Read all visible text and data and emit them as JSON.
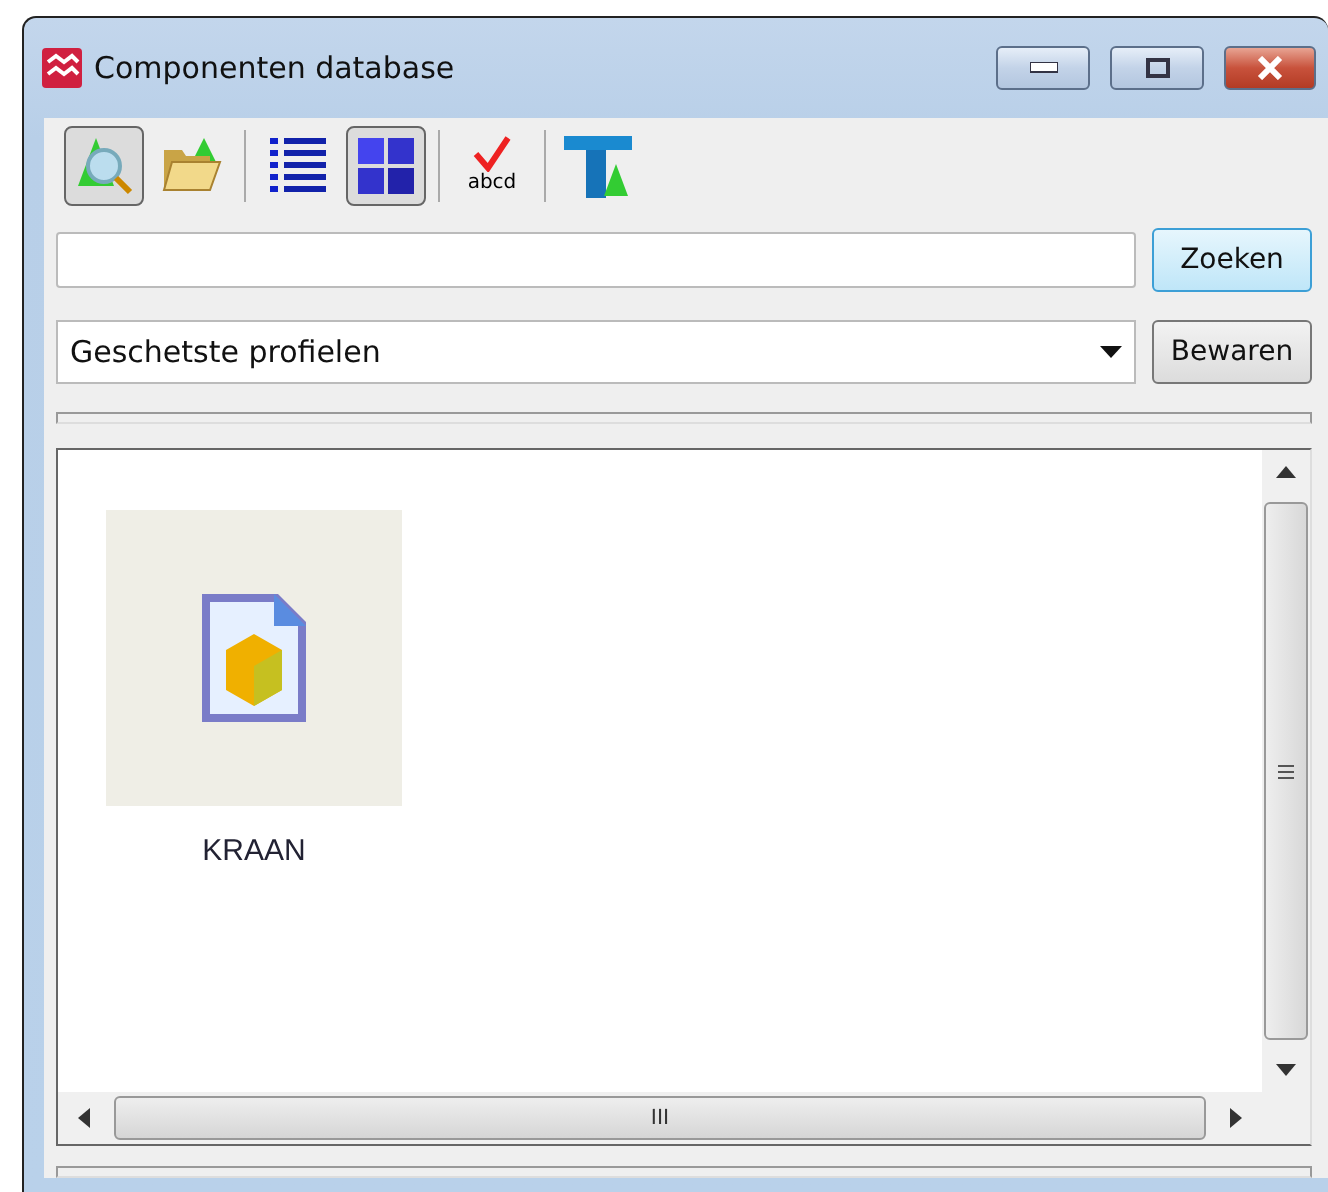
{
  "window": {
    "title": "Componenten database"
  },
  "toolbar": [
    {
      "kind": "search",
      "selected": true
    },
    {
      "kind": "open",
      "selected": false
    },
    {
      "kind": "separator"
    },
    {
      "kind": "list",
      "selected": false
    },
    {
      "kind": "tiles",
      "selected": true
    },
    {
      "kind": "separator"
    },
    {
      "kind": "spell",
      "text": "abcd",
      "selected": false
    },
    {
      "kind": "separator"
    },
    {
      "kind": "profile",
      "selected": false
    }
  ],
  "search": {
    "button": "Zoeken"
  },
  "category": {
    "value": "Geschetste profielen",
    "button": "Bewaren"
  },
  "items": [
    {
      "label": "KRAAN",
      "selected": false
    }
  ],
  "scrollbar": {
    "grip": "III"
  }
}
